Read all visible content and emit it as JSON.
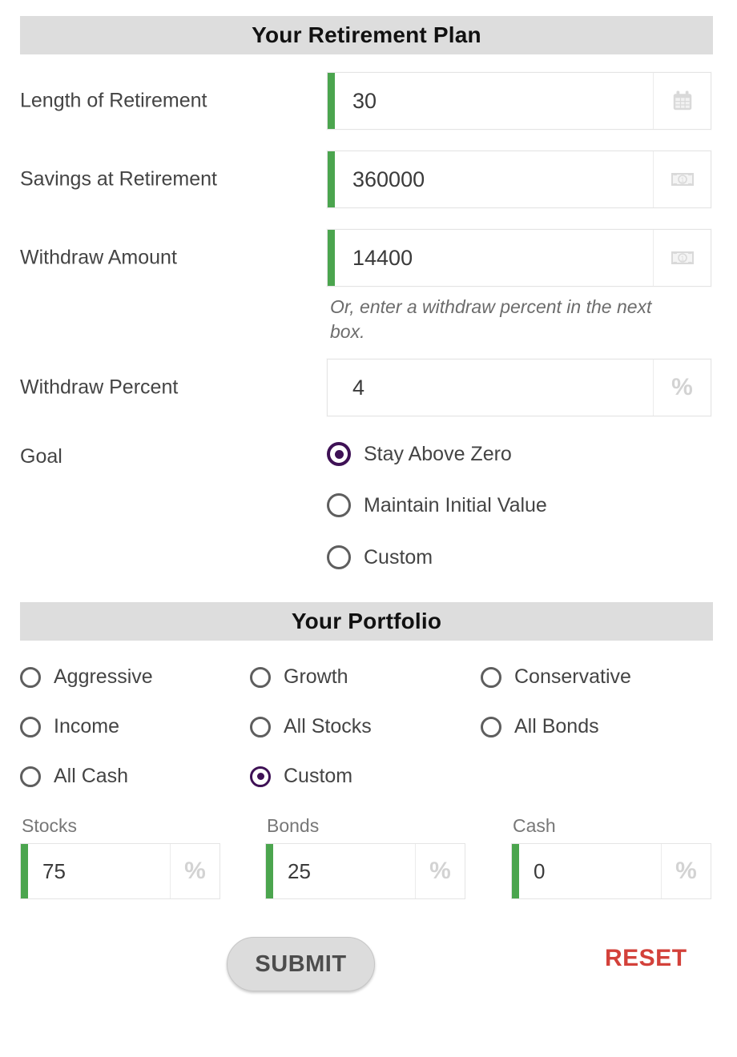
{
  "plan": {
    "header": "Your Retirement Plan",
    "fields": [
      {
        "label": "Length of Retirement",
        "value": "30",
        "addon_icon": "calendar-icon",
        "accent": true
      },
      {
        "label": "Savings at Retirement",
        "value": "360000",
        "addon_icon": "money-icon",
        "accent": true
      },
      {
        "label": "Withdraw Amount",
        "value": "14400",
        "addon_icon": "money-icon",
        "accent": true
      },
      {
        "label": "Withdraw Percent",
        "value": "4",
        "addon_icon": "percent-icon",
        "addon_text": "%",
        "accent": false
      }
    ],
    "helper_text": "Or, enter a withdraw percent in the next box.",
    "goal": {
      "label": "Goal",
      "options": [
        {
          "label": "Stay Above Zero",
          "checked": true
        },
        {
          "label": "Maintain Initial Value",
          "checked": false
        },
        {
          "label": "Custom",
          "checked": false
        }
      ]
    }
  },
  "portfolio": {
    "header": "Your Portfolio",
    "options": [
      {
        "label": "Aggressive",
        "checked": false
      },
      {
        "label": "Growth",
        "checked": false
      },
      {
        "label": "Conservative",
        "checked": false
      },
      {
        "label": "Income",
        "checked": false
      },
      {
        "label": "All Stocks",
        "checked": false
      },
      {
        "label": "All Bonds",
        "checked": false
      },
      {
        "label": "All Cash",
        "checked": false
      },
      {
        "label": "Custom",
        "checked": true
      }
    ],
    "allocations": [
      {
        "caption": "Stocks",
        "value": "75",
        "addon_text": "%"
      },
      {
        "caption": "Bonds",
        "value": "25",
        "addon_text": "%"
      },
      {
        "caption": "Cash",
        "value": "0",
        "addon_text": "%"
      }
    ]
  },
  "actions": {
    "submit_label": "SUBMIT",
    "reset_label": "RESET"
  },
  "colors": {
    "accent_green": "#4ba54e",
    "radio_checked": "#3e1155",
    "reset_red": "#d3413a",
    "header_bg": "#dddddd"
  }
}
